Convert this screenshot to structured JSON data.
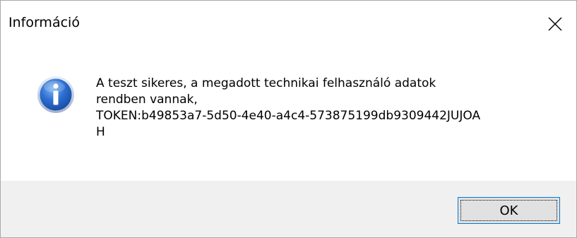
{
  "dialog": {
    "title": "Információ",
    "close_icon": "close-icon",
    "message_icon": "information-icon",
    "message_lines": [
      "A teszt sikeres, a megadott technikai felhasználó adatok",
      "rendben vannak,",
      "TOKEN:b49853a7-5d50-4e40-a4c4-573875199db9309442JUJOA",
      "H"
    ],
    "ok_label": "OK"
  },
  "colors": {
    "footer_bg": "#f0f0f0",
    "button_border": "#0078d7",
    "button_bg": "#e1e1e1"
  }
}
